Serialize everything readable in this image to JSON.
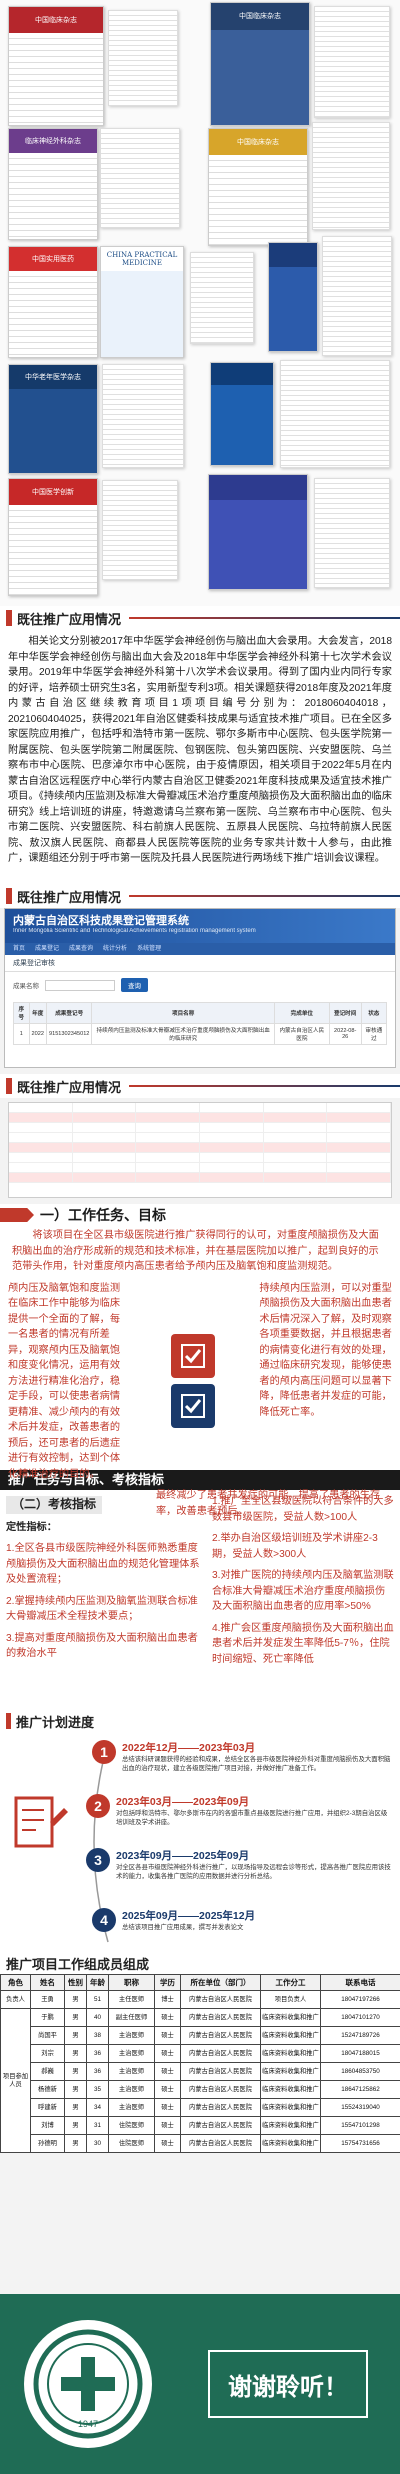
{
  "journals": {
    "cover1": "中国临床杂志",
    "cover2": "中国临床杂志",
    "cover3": "临床神经外科杂志",
    "cover4": "中国实用医药",
    "cover5": "CHINA PRACTICAL MEDICINE",
    "cover6": "中华老年医学杂志",
    "cover7": "中国医学创新"
  },
  "section1": {
    "title": "既往推广应用情况",
    "text": "相关论文分别被2017年中华医学会神经创伤与脑出血大会录用。大会发言，2018年中华医学会神经创伤与脑出血大会及2018年中华医学会神经外科第十七次学术会议录用。2019年中华医学会神经外科第十八次学术会议录用。得到了国内业内同行专家的好评，培养硕士研究生3名，实用新型专利3项。相关课题获得2018年度及2021年度内蒙古自治区继续教育项目1项项目编号分别为：2018060404018，2021060404025，获得2021年自治区健委科技成果与适宜技术推广项目。已在全区多家医院应用推广，包括呼和浩特市第一医院、鄂尔多斯市中心医院、包头医学院第一附属医院、包头医学院第二附属医院、包钢医院、包头第四医院、兴安盟医院、乌兰察布市中心医院、巴彦淖尔市中心医院，由于疫情原因，相关项目于2022年5月在内蒙古自治区远程医疗中心举行内蒙古自治区卫健委2021年度科技成果及适宜技术推广项目。《持续颅内压监测及标准大骨瓣减压术治疗重度颅脑损伤及大面积脑出血的临床研究》线上培训班的讲座，特邀邀请乌兰察布第一医院、乌兰察布市中心医院、包头市第二医院、兴安盟医院、科右前旗人民医院、五原县人民医院、乌拉特前旗人民医院、敖汉旗人民医院、商都县人民医院等医院的业务专家共计数十人参与，由此推广，课题组还分别于呼市第一医院及托县人民医院进行两场线下推广培训会议课程。"
  },
  "system": {
    "banner_title": "内蒙古自治区科技成果登记管理系统",
    "banner_sub": "Inner Mongolia Scientific and Technological Achievements registration management system",
    "nav": [
      "首页",
      "成果登记",
      "成果查询",
      "统计分析",
      "系统管理"
    ],
    "tab": "成果登记审核",
    "form_label": "成果名称",
    "search_btn": "查询",
    "columns": [
      "序号",
      "年度",
      "成果登记号",
      "项目名称",
      "完成单位",
      "登记时间",
      "状态"
    ],
    "rows": [
      [
        "1",
        "2022",
        "9151302345012",
        "持续颅内压监测及标准大骨瓣减压术治疗重度颅脑损伤及大面积脑出血的临床研究",
        "内蒙古自治区人民医院",
        "2022-08-26",
        "审核通过"
      ]
    ]
  },
  "section2": {
    "title": "既往推广应用情况"
  },
  "tasks": {
    "heading": "一）工作任务、目标",
    "intro": "将该项目在全区县市级医院进行推广获得同行的认可，对重度颅脑损伤及大面积脑出血的治疗形成新的规范和技术标准，并在基层医院加以推广，起到良好的示范带头作用，针对重度颅内高压患者给予颅内压及脑氧饱和度监测规范。",
    "left": "颅内压及脑氧饱和度监测在临床工作中能够为临床提供一个全面的了解，每一名患者的情况有所差异，观察颅内压及脑氧饱和度变化情况，运用有效方法进行精准化治疗，稳定手段，可以使患者病情更精准、减少颅内的有效术后并发症，改善患者的预后，还可患者的后遗症进行有效控制，达到个体化精准治疗的目的。",
    "right": "持续颅内压监测，可以对重型颅脑损伤及大面积脑出血患者术后情况深入了解，及时观察各项重要数据，并且根据患者的病情变化进行有效的处理，通过临床研究发现，能够使患者的颅内高压问题可以显著下降，降低患者并发症的可能，降低死亡率。",
    "bottom": "最终减少了患者并发症的可能，提高了患者的生存率，改善患者预后。"
  },
  "indicators": {
    "heading": "推广任务与目标、考核指标",
    "sub": "（二）考核指标",
    "lead": "定性指标：",
    "left_items": [
      "1.全区各县市级医院神经外科医师熟悉重度颅脑损伤及大面积脑出血的规范化管理体系及处置流程；",
      "2.掌握持续颅内压监测及脑氧监测联合标准大骨瓣减压术全程技术要点；",
      "3.提高对重度颅脑损伤及大面积脑出血患者的救治水平"
    ],
    "right_lead": "定量指标：",
    "right_items": [
      "1.推广至全区县级医院以符合条件的大多数县市级医院，受益人数>100人",
      "2.举办自治区级培训班及学术讲座2-3期，受益人数>300人",
      "3.对推广医院的持续颅内压及脑氧监测联合标准大骨瓣减压术治疗重度颅脑损伤及大面积脑出血患者的应用率>50%",
      "4.推广会区重度颅脑损伤及大面积脑出血患者术后并发症发生率降低5-7％，住院时间缩短、死亡率降低"
    ]
  },
  "plan": {
    "heading": "推广计划进度",
    "steps": [
      {
        "num": "1",
        "date": "2022年12月——2023年03月",
        "desc": "总结该科研课题获得的经验和成果，总结全区各县市级医院神经外科对重度颅脑损伤及大面积脑出血的治疗现状，建立各级医院推广项目对接，并做好推广准备工作。"
      },
      {
        "num": "2",
        "date": "2023年03月——2023年09月",
        "desc": "对包括呼和浩特市、鄂尔多斯市在内的各盟市重点县级医院进行推广应用，并组织2-3期自治区级培训班及学术讲座。"
      },
      {
        "num": "3",
        "date": "2023年09月——2025年09月",
        "desc": "对全区各县市级医院神经外科进行推广，以现场指导及远程会诊等形式，提高各推广医院应用该技术的能力，收集各推广医院的应用数据并进行分析总结。"
      },
      {
        "num": "4",
        "date": "2025年09月——2025年12月",
        "desc": "总结该项目推广应用成果，撰写并发表论文"
      }
    ]
  },
  "staff": {
    "heading": "推广项目工作组成员组成",
    "columns": [
      "角色",
      "姓名",
      "性别",
      "年龄",
      "职称",
      "学历",
      "所在单位（部门）",
      "工作分工",
      "联系电话"
    ],
    "rows": [
      [
        "负责人",
        "王勇",
        "男",
        "51",
        "主任医师",
        "博士",
        "内蒙古自治区人民医院",
        "项目负责人",
        "18047197266"
      ],
      [
        "",
        "于鹏",
        "男",
        "40",
        "副主任医师",
        "硕士",
        "内蒙古自治区人民医院",
        "临床资料收集和推广",
        "18047101270"
      ],
      [
        "",
        "尚国平",
        "男",
        "38",
        "主治医师",
        "硕士",
        "内蒙古自治区人民医院",
        "临床资料收集和推广",
        "15247189726"
      ],
      [
        "项目参加人员",
        "刘宗",
        "男",
        "36",
        "主治医师",
        "硕士",
        "内蒙古自治区人民医院",
        "临床资料收集和推广",
        "18047188015"
      ],
      [
        "",
        "郝巍",
        "男",
        "36",
        "主治医师",
        "硕士",
        "内蒙古自治区人民医院",
        "临床资料收集和推广",
        "18604853750"
      ],
      [
        "",
        "杨德新",
        "男",
        "35",
        "主治医师",
        "硕士",
        "内蒙古自治区人民医院",
        "临床资料收集和推广",
        "18647125862"
      ],
      [
        "",
        "呼建新",
        "男",
        "34",
        "主治医师",
        "硕士",
        "内蒙古自治区人民医院",
        "临床资料收集和推广",
        "15524319040"
      ],
      [
        "",
        "刘博",
        "男",
        "31",
        "住院医师",
        "硕士",
        "内蒙古自治区人民医院",
        "临床资料收集和推广",
        "15547101298"
      ],
      [
        "",
        "孙德明",
        "男",
        "30",
        "住院医师",
        "硕士",
        "内蒙古自治区人民医院",
        "临床资料收集和推广",
        "15754731656"
      ]
    ]
  },
  "footer": {
    "thanks": "谢谢聆听！",
    "logo_year": "1947"
  },
  "colors": {
    "accent": "#c0392b",
    "navy": "#1a3a6b",
    "footer": "#1f6c55"
  }
}
